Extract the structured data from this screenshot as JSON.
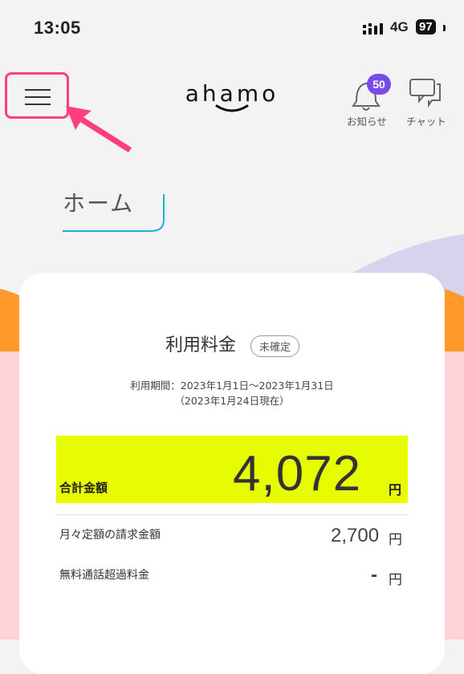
{
  "status": {
    "time": "13:05",
    "network": "4G",
    "battery": "97"
  },
  "header": {
    "logo": "ahamo",
    "notifications": {
      "label": "お知らせ",
      "badge": "50"
    },
    "chat": {
      "label": "チャット"
    }
  },
  "page": {
    "title": "ホーム"
  },
  "billing": {
    "title": "利用料金",
    "status": "未確定",
    "period": "利用期間：2023年1月1日〜2023年1月31日",
    "as_of": "（2023年1月24日現在）",
    "total_label": "合計金額",
    "total_amount": "4,072",
    "currency": "円",
    "rows": [
      {
        "label": "月々定額の請求金額",
        "value": "2,700",
        "unit": "円"
      },
      {
        "label": "無料通話超過料金",
        "value": "-",
        "unit": "円"
      }
    ]
  },
  "colors": {
    "accent_highlight": "#e8fc00",
    "annotation_pink": "#ff3e7f",
    "badge_purple": "#7b4bea",
    "underline_cyan": "#19b3d6"
  }
}
